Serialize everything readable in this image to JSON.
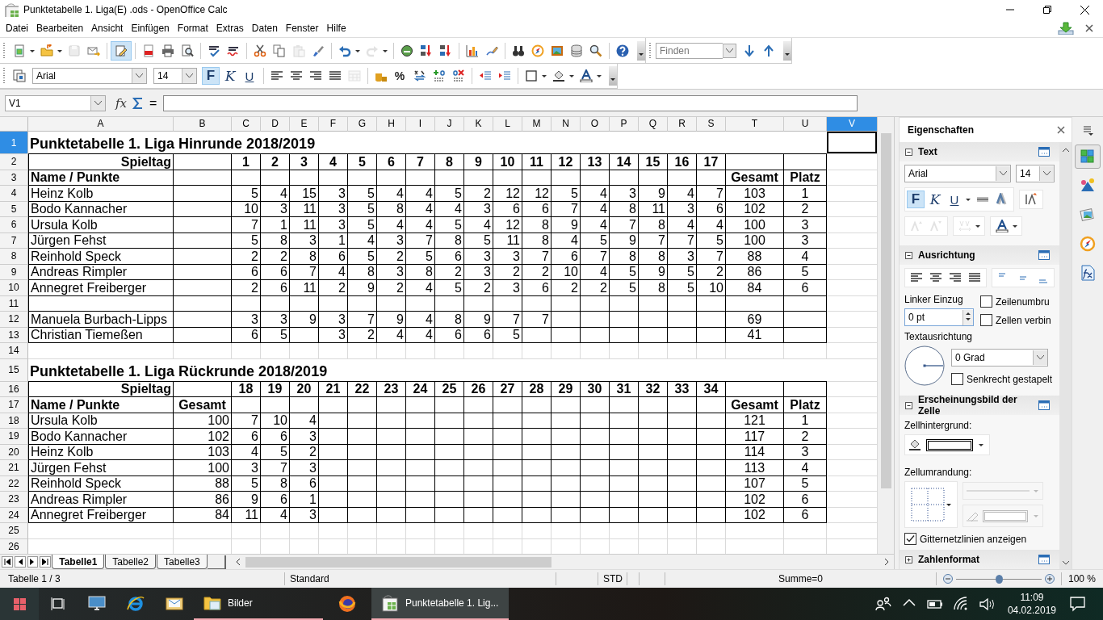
{
  "window": {
    "title": "Punktetabelle 1. Liga(E) .ods - OpenOffice Calc"
  },
  "menu": [
    {
      "label": "Datei"
    },
    {
      "label": "Bearbeiten"
    },
    {
      "label": "Ansicht"
    },
    {
      "label": "Einfügen"
    },
    {
      "label": "Format"
    },
    {
      "label": "Extras"
    },
    {
      "label": "Daten"
    },
    {
      "label": "Fenster"
    },
    {
      "label": "Hilfe"
    }
  ],
  "standard_toolbar": {
    "edit_mode": true,
    "finder": {
      "placeholder": "Finden"
    }
  },
  "formatting_toolbar": {
    "font": "Arial",
    "size": "14",
    "buttons": [
      {
        "label": "F",
        "on": true
      },
      {
        "label": "K",
        "on": false
      },
      {
        "label": "U",
        "on": false
      }
    ],
    "percent": "%"
  },
  "formula_bar": {
    "cell_reference": "V1",
    "function_wizard": "fx",
    "equals": "="
  },
  "columns": [
    {
      "label": "A",
      "selected": false
    },
    {
      "label": "B",
      "selected": false
    },
    {
      "label": "C",
      "selected": false
    },
    {
      "label": "D",
      "selected": false
    },
    {
      "label": "E",
      "selected": false
    },
    {
      "label": "F",
      "selected": false
    },
    {
      "label": "G",
      "selected": false
    },
    {
      "label": "H",
      "selected": false
    },
    {
      "label": "I",
      "selected": false
    },
    {
      "label": "J",
      "selected": false
    },
    {
      "label": "K",
      "selected": false
    },
    {
      "label": "L",
      "selected": false
    },
    {
      "label": "M",
      "selected": false
    },
    {
      "label": "N",
      "selected": false
    },
    {
      "label": "O",
      "selected": false
    },
    {
      "label": "P",
      "selected": false
    },
    {
      "label": "Q",
      "selected": false
    },
    {
      "label": "R",
      "selected": false
    },
    {
      "label": "S",
      "selected": false
    },
    {
      "label": "T",
      "selected": false
    },
    {
      "label": "U",
      "selected": false
    },
    {
      "label": "V",
      "selected": true
    }
  ],
  "rows": [
    {
      "number": "1",
      "kind": "title",
      "selected": true,
      "cells": [
        "Punktetabelle 1. Liga Hinrunde 2018/2019"
      ]
    },
    {
      "number": "2",
      "kind": "matchdays",
      "selected": false,
      "cells": [
        "Spieltag",
        null,
        "1",
        "2",
        "3",
        "4",
        "5",
        "6",
        "7",
        "8",
        "9",
        "10",
        "11",
        "12",
        "13",
        "14",
        "15",
        "16",
        "17",
        null,
        null
      ]
    },
    {
      "number": "3",
      "kind": "header",
      "selected": false,
      "cells": [
        "Name / Punkte",
        null,
        null,
        null,
        null,
        null,
        null,
        null,
        null,
        null,
        null,
        null,
        null,
        null,
        null,
        null,
        null,
        null,
        null,
        "Gesamt",
        "Platz"
      ]
    },
    {
      "number": "4",
      "kind": "data",
      "selected": false,
      "cells": [
        "Heinz Kolb",
        null,
        "5",
        "4",
        "15",
        "3",
        "5",
        "4",
        "4",
        "5",
        "2",
        "12",
        "12",
        "5",
        "4",
        "3",
        "9",
        "4",
        "7",
        "103",
        "1"
      ]
    },
    {
      "number": "5",
      "kind": "data",
      "selected": false,
      "cells": [
        "Bodo Kannacher",
        null,
        "10",
        "3",
        "11",
        "3",
        "5",
        "8",
        "4",
        "4",
        "3",
        "6",
        "6",
        "7",
        "4",
        "8",
        "11",
        "3",
        "6",
        "102",
        "2"
      ]
    },
    {
      "number": "6",
      "kind": "data",
      "selected": false,
      "cells": [
        "Ursula Kolb",
        null,
        "7",
        "1",
        "11",
        "3",
        "5",
        "4",
        "4",
        "5",
        "4",
        "12",
        "8",
        "9",
        "4",
        "7",
        "8",
        "4",
        "4",
        "100",
        "3"
      ]
    },
    {
      "number": "7",
      "kind": "data",
      "selected": false,
      "cells": [
        "Jürgen Fehst",
        null,
        "5",
        "8",
        "3",
        "1",
        "4",
        "3",
        "7",
        "8",
        "5",
        "11",
        "8",
        "4",
        "5",
        "9",
        "7",
        "7",
        "5",
        "100",
        "3"
      ]
    },
    {
      "number": "8",
      "kind": "data",
      "selected": false,
      "cells": [
        "Reinhold Speck",
        null,
        "2",
        "2",
        "8",
        "6",
        "5",
        "2",
        "5",
        "6",
        "3",
        "3",
        "7",
        "6",
        "7",
        "8",
        "8",
        "3",
        "7",
        "88",
        "4"
      ]
    },
    {
      "number": "9",
      "kind": "data",
      "selected": false,
      "cells": [
        "Andreas Rimpler",
        null,
        "6",
        "6",
        "7",
        "4",
        "8",
        "3",
        "8",
        "2",
        "3",
        "2",
        "2",
        "10",
        "4",
        "5",
        "9",
        "5",
        "2",
        "86",
        "5"
      ]
    },
    {
      "number": "10",
      "kind": "data",
      "selected": false,
      "cells": [
        "Annegret Freiberger",
        null,
        "2",
        "6",
        "11",
        "2",
        "9",
        "2",
        "4",
        "5",
        "2",
        "3",
        "6",
        "2",
        "2",
        "5",
        "8",
        "5",
        "10",
        "84",
        "6"
      ]
    },
    {
      "number": "11",
      "kind": "data",
      "selected": false,
      "cells": []
    },
    {
      "number": "12",
      "kind": "data",
      "selected": false,
      "cells": [
        "Manuela Burbach-Lipps",
        null,
        "3",
        "3",
        "9",
        "3",
        "7",
        "9",
        "4",
        "8",
        "9",
        "7",
        "7",
        null,
        null,
        null,
        null,
        null,
        null,
        "69",
        null
      ]
    },
    {
      "number": "13",
      "kind": "data",
      "selected": false,
      "cells": [
        "Christian Tiemeßen",
        null,
        "6",
        "5",
        null,
        "3",
        "2",
        "4",
        "4",
        "6",
        "6",
        "5",
        null,
        null,
        null,
        null,
        null,
        null,
        null,
        "41",
        null
      ]
    },
    {
      "number": "14",
      "kind": "plain",
      "selected": false,
      "cells": []
    },
    {
      "number": "15",
      "kind": "title",
      "selected": false,
      "cells": [
        "Punktetabelle 1. Liga Rückrunde 2018/2019"
      ]
    },
    {
      "number": "16",
      "kind": "matchdays",
      "selected": false,
      "cells": [
        "Spieltag",
        null,
        "18",
        "19",
        "20",
        "21",
        "22",
        "23",
        "24",
        "25",
        "26",
        "27",
        "28",
        "29",
        "30",
        "31",
        "32",
        "33",
        "34",
        null,
        null
      ]
    },
    {
      "number": "17",
      "kind": "header",
      "selected": false,
      "cells": [
        "Name / Punkte",
        "Gesamt",
        null,
        null,
        null,
        null,
        null,
        null,
        null,
        null,
        null,
        null,
        null,
        null,
        null,
        null,
        null,
        null,
        null,
        "Gesamt",
        "Platz"
      ]
    },
    {
      "number": "18",
      "kind": "data",
      "selected": false,
      "cells": [
        "Ursula Kolb",
        "100",
        "7",
        "10",
        "4",
        null,
        null,
        null,
        null,
        null,
        null,
        null,
        null,
        null,
        null,
        null,
        null,
        null,
        null,
        "121",
        "1"
      ]
    },
    {
      "number": "19",
      "kind": "data",
      "selected": false,
      "cells": [
        "Bodo Kannacher",
        "102",
        "6",
        "6",
        "3",
        null,
        null,
        null,
        null,
        null,
        null,
        null,
        null,
        null,
        null,
        null,
        null,
        null,
        null,
        "117",
        "2"
      ]
    },
    {
      "number": "20",
      "kind": "data",
      "selected": false,
      "cells": [
        "Heinz Kolb",
        "103",
        "4",
        "5",
        "2",
        null,
        null,
        null,
        null,
        null,
        null,
        null,
        null,
        null,
        null,
        null,
        null,
        null,
        null,
        "114",
        "3"
      ]
    },
    {
      "number": "21",
      "kind": "data",
      "selected": false,
      "cells": [
        "Jürgen Fehst",
        "100",
        "3",
        "7",
        "3",
        null,
        null,
        null,
        null,
        null,
        null,
        null,
        null,
        null,
        null,
        null,
        null,
        null,
        null,
        "113",
        "4"
      ]
    },
    {
      "number": "22",
      "kind": "data",
      "selected": false,
      "cells": [
        "Reinhold Speck",
        "88",
        "5",
        "8",
        "6",
        null,
        null,
        null,
        null,
        null,
        null,
        null,
        null,
        null,
        null,
        null,
        null,
        null,
        null,
        "107",
        "5"
      ]
    },
    {
      "number": "23",
      "kind": "data",
      "selected": false,
      "cells": [
        "Andreas Rimpler",
        "86",
        "9",
        "6",
        "1",
        null,
        null,
        null,
        null,
        null,
        null,
        null,
        null,
        null,
        null,
        null,
        null,
        null,
        null,
        "102",
        "6"
      ]
    },
    {
      "number": "24",
      "kind": "data",
      "selected": false,
      "cells": [
        "Annegret Freiberger",
        "84",
        "11",
        "4",
        "3",
        null,
        null,
        null,
        null,
        null,
        null,
        null,
        null,
        null,
        null,
        null,
        null,
        null,
        null,
        "102",
        "6"
      ]
    },
    {
      "number": "25",
      "kind": "plain",
      "selected": false,
      "cells": []
    },
    {
      "number": "26",
      "kind": "plain",
      "selected": false,
      "cells": []
    }
  ],
  "sheet_tabs": [
    {
      "label": "Tabelle1",
      "selected": true
    },
    {
      "label": "Tabelle2",
      "selected": false
    },
    {
      "label": "Tabelle3",
      "selected": false
    }
  ],
  "sidebar": {
    "title": "Eigenschaften",
    "text": {
      "title": "Text",
      "expanded": true,
      "font": "Arial",
      "size": "14",
      "buttons": [
        {
          "label": "F",
          "on": true
        },
        {
          "label": "K",
          "on": false
        },
        {
          "label": "U",
          "on": false
        }
      ]
    },
    "alignment": {
      "title": "Ausrichtung",
      "expanded": true,
      "indent_label": "Linker Einzug",
      "indent_value": "0 pt",
      "wrap": {
        "label": "Zeilenumbru",
        "checked": false
      },
      "merge": {
        "label": "Zellen verbin",
        "checked": false
      },
      "orientation_label": "Textausrichtung",
      "angle": "0 Grad",
      "stacked": {
        "label": "Senkrecht gestapelt",
        "checked": false
      }
    },
    "appearance": {
      "title": "Erscheinungsbild der Zelle",
      "expanded": true,
      "background_label": "Zellhintergrund:",
      "border_label": "Zellumrandung:",
      "gridlines": {
        "label": "Gitternetzlinien anzeigen",
        "checked": true
      }
    },
    "number_format": {
      "title": "Zahlenformat",
      "expanded": false
    },
    "deck_tabs": [
      {
        "selected": true
      },
      {
        "selected": false
      },
      {
        "selected": false
      },
      {
        "selected": false
      },
      {
        "selected": false
      }
    ]
  },
  "status_bar": {
    "sheet": "Tabelle 1 / 3",
    "page_style": "Standard",
    "selection_mode": "STD",
    "sum": "Summe=0",
    "zoom": {
      "level": 0.5,
      "reading": "100 %"
    }
  },
  "taskbar": {
    "apps": [
      {
        "kind": "monitor",
        "selected": false
      },
      {
        "kind": "browser",
        "selected": false
      },
      {
        "kind": "mail",
        "selected": false
      },
      {
        "kind": "folder",
        "label": "Bilder",
        "selected": false
      },
      {
        "kind": "firefox",
        "selected": false
      },
      {
        "kind": "calc",
        "label": "Punktetabelle 1. Lig...",
        "selected": true
      }
    ],
    "time": "11:09",
    "date": "04.02.2019"
  }
}
